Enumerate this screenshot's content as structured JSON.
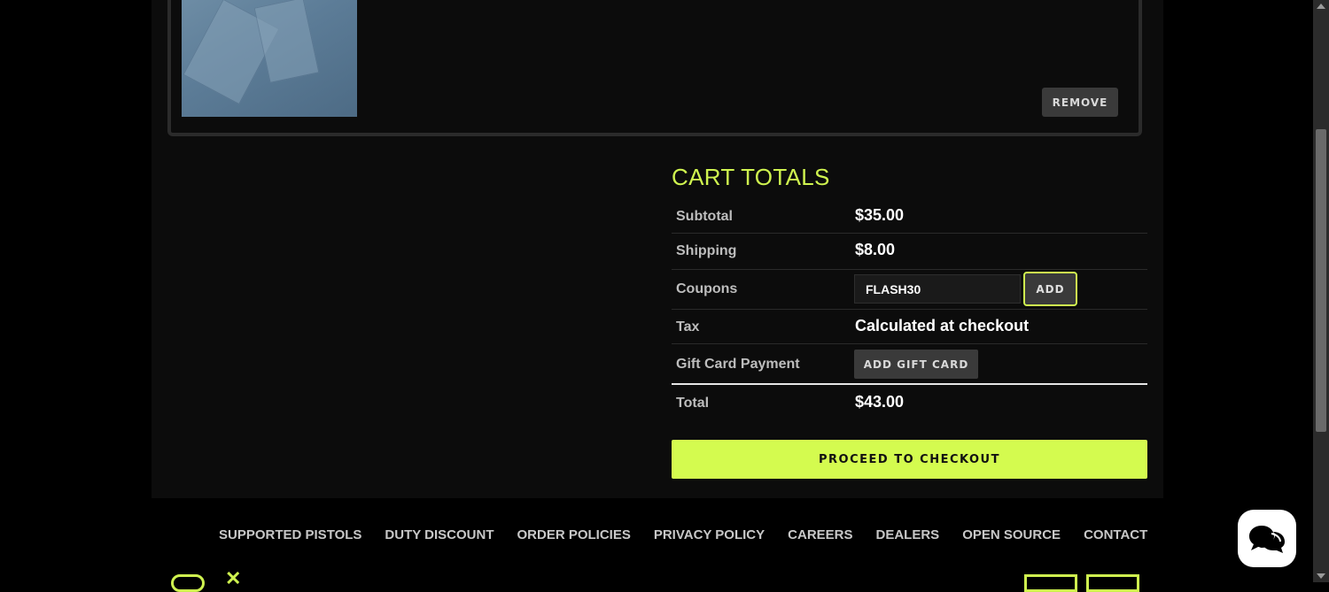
{
  "cart_item": {
    "remove_label": "REMOVE",
    "thumbnail_icon": "product-image-icon"
  },
  "cart_totals": {
    "title": "CART TOTALS",
    "rows": {
      "subtotal": {
        "label": "Subtotal",
        "value": "$35.00"
      },
      "shipping": {
        "label": "Shipping",
        "value": "$8.00"
      },
      "coupons": {
        "label": "Coupons",
        "input_value": "FLASH30",
        "add_label": "ADD"
      },
      "tax": {
        "label": "Tax",
        "value": "Calculated at checkout"
      },
      "gift_card": {
        "label": "Gift Card Payment",
        "button_label": "ADD GIFT CARD"
      },
      "total": {
        "label": "Total",
        "value": "$43.00"
      }
    },
    "checkout_label": "PROCEED TO CHECKOUT"
  },
  "footer": {
    "nav": [
      "SUPPORTED PISTOLS",
      "DUTY DISCOUNT",
      "ORDER POLICIES",
      "PRIVACY POLICY",
      "CAREERS",
      "DEALERS",
      "OPEN SOURCE",
      "CONTACT"
    ],
    "social_icons": [
      "instagram-icon",
      "x-icon"
    ],
    "payment_icons": [
      "card-icon",
      "card-icon"
    ]
  },
  "chat": {
    "icon": "chat-icon"
  },
  "colors": {
    "accent": "#cff34f",
    "checkout_bg": "#d4fb4f",
    "page_bg": "#0c0c0c",
    "button_bg": "#3a3a3a"
  }
}
